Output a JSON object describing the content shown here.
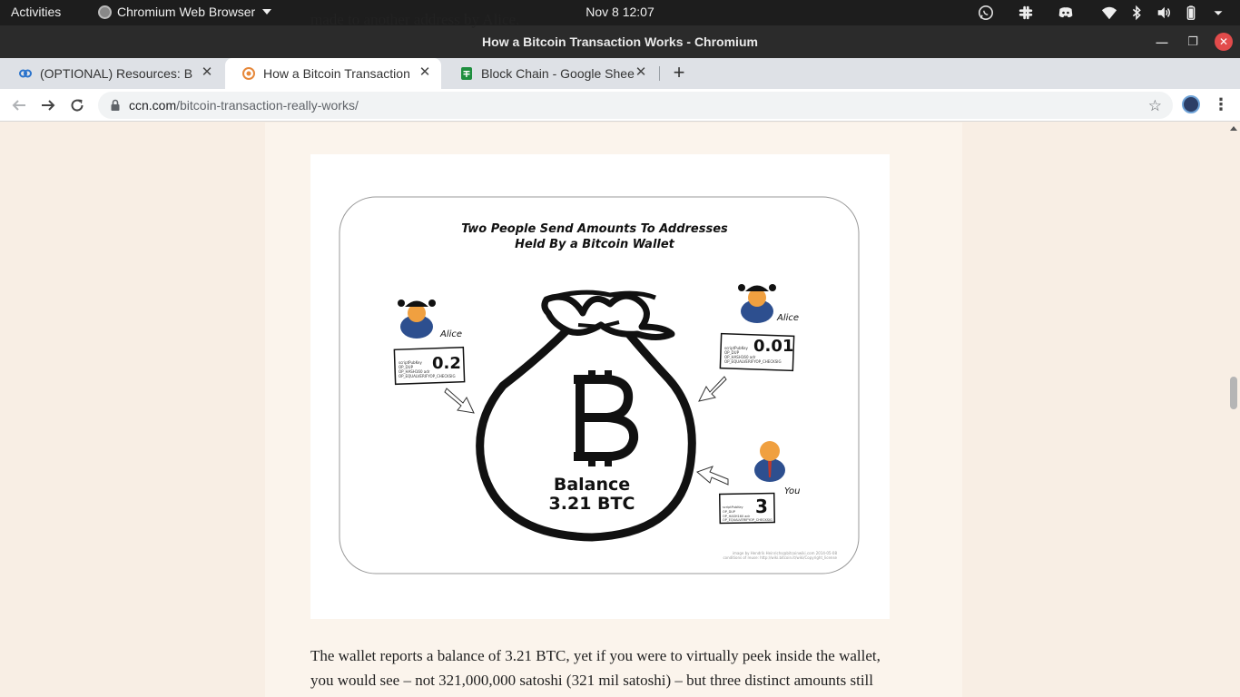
{
  "system_bar": {
    "activities": "Activities",
    "app_name": "Chromium Web Browser",
    "clock": "Nov 8  12:07",
    "tray_icons": [
      "whatsapp-icon",
      "slack-icon",
      "discord-icon",
      "wifi-icon",
      "bluetooth-icon",
      "volume-icon",
      "battery-icon",
      "power-menu-icon"
    ]
  },
  "window": {
    "title": "How a Bitcoin Transaction Works - Chromium"
  },
  "tabs": [
    {
      "label": "(OPTIONAL) Resources: B",
      "icon": "coursera-icon"
    },
    {
      "label": "How a Bitcoin Transaction",
      "icon": "ccn-icon",
      "active": true
    },
    {
      "label": "Block Chain - Google Shee",
      "icon": "google-sheets-icon"
    }
  ],
  "toolbar": {
    "url_domain": "ccn.com",
    "url_path": "/bitcoin-transaction-really-works/"
  },
  "article": {
    "text_top": "made to another address by Alice.",
    "text_bottom": "The wallet reports a balance of 3.21 BTC, yet if you were to virtually peek inside the wallet, you would see – not 321,000,000 satoshi (321 mil satoshi) – but three distinct amounts still",
    "figure": {
      "title_line1": "Two People Send Amounts To Addresses",
      "title_line2": "Held By a Bitcoin Wallet",
      "balance_label": "Balance",
      "balance_value": "3.21 BTC",
      "senders": [
        {
          "name": "Alice",
          "amount": "0.2",
          "script": [
            "scriptPubKey",
            "OP_DUP",
            "OP_HASH160 adr",
            "OP_EQUALVERIFYOP_CHECKSIG"
          ]
        },
        {
          "name": "Alice",
          "amount": "0.01",
          "script": [
            "scriptPubKey",
            "OP_DUP",
            "OP_HASH160 adr",
            "OP_EQUALVERIFYOP_CHECKSIG"
          ]
        },
        {
          "name": "You",
          "amount": "3",
          "script": [
            "scriptPubKey",
            "OP_DUP",
            "OP_HASH160 adr",
            "OP_EQUALVERIFYOP_CHECKSIG"
          ]
        }
      ],
      "credit_line1": "image by Hendrik Heinrichs@bitcoinwiki.com 2014-05-08",
      "credit_line2": "conditions of reuse: http://wiki.bitcoin.it/wiki/Copyright_license"
    }
  },
  "colors": {
    "page_bg": "#f8eee4",
    "tab_strip": "#dee1e6",
    "title_bar": "#2b2b2b",
    "close_button": "#e24b4b"
  }
}
